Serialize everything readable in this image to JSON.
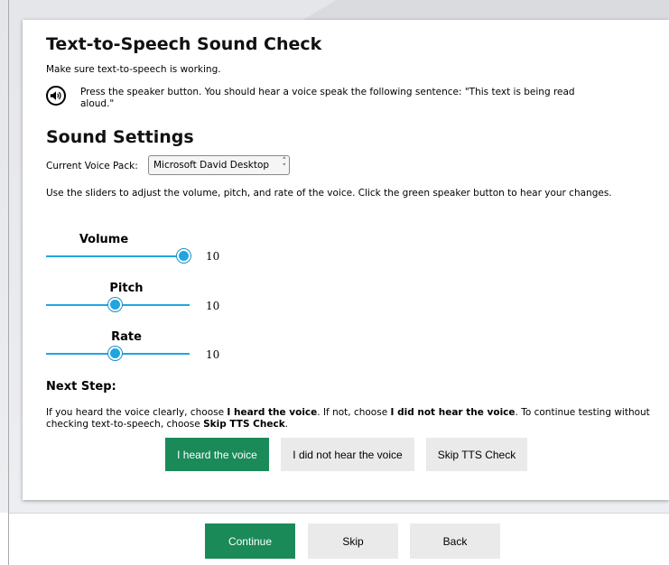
{
  "sound_check": {
    "title": "Text-to-Speech Sound Check",
    "subtitle": "Make sure text-to-speech is working.",
    "speaker_instruction": "Press the speaker button. You should hear a voice speak the following sentence: \"This text is being read aloud.\""
  },
  "sound_settings": {
    "heading": "Sound Settings",
    "voice_pack_label": "Current Voice Pack:",
    "voice_pack_value": "Microsoft David Desktop",
    "instructions": "Use the sliders to adjust the volume, pitch, and rate of the voice. Click the green speaker button to hear your changes.",
    "sliders": {
      "volume": {
        "label": "Volume",
        "value": "10",
        "level": 1.0
      },
      "pitch": {
        "label": "Pitch",
        "value": "10",
        "level": 0.48
      },
      "rate": {
        "label": "Rate",
        "value": "10",
        "level": 0.48
      }
    }
  },
  "next_step": {
    "heading": "Next Step:",
    "text_1": "If you heard the voice clearly, choose ",
    "bold_1": "I heard the voice",
    "text_2": ". If not, choose ",
    "bold_2": "I did not hear the voice",
    "text_3": ". To continue testing without checking text-to-speech, choose ",
    "bold_3": "Skip TTS Check",
    "text_4": ".",
    "buttons": {
      "heard": "I heard the voice",
      "not_heard": "I did not hear the voice",
      "skip_tts": "Skip TTS Check"
    }
  },
  "footer": {
    "continue": "Continue",
    "skip": "Skip",
    "back": "Back"
  },
  "colors": {
    "accent_green": "#1a8a58",
    "slider_blue": "#1fa6e0"
  }
}
